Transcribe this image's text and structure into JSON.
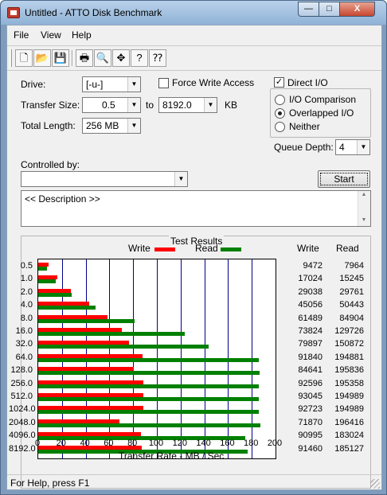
{
  "window": {
    "title": "Untitled - ATTO Disk Benchmark",
    "min_glyph": "—",
    "max_glyph": "□",
    "close_glyph": "X"
  },
  "menu": [
    "File",
    "View",
    "Help"
  ],
  "toolbar": {
    "buttons": [
      {
        "name": "new-icon",
        "glyph": "🗋"
      },
      {
        "name": "open-icon",
        "glyph": "📂"
      },
      {
        "name": "save-icon",
        "glyph": "💾"
      },
      {
        "name": "print-icon",
        "glyph": "🖶"
      },
      {
        "name": "print-preview-icon",
        "glyph": "🔍"
      },
      {
        "name": "move-icon",
        "glyph": "✥"
      },
      {
        "name": "help-icon",
        "glyph": "?"
      },
      {
        "name": "context-help-icon",
        "glyph": "⁇"
      }
    ]
  },
  "form": {
    "drive_label": "Drive:",
    "drive_value": "[-u-]",
    "force_write_label": "Force Write Access",
    "force_write_checked": false,
    "direct_io_label": "Direct I/O",
    "direct_io_checked": true,
    "direct_io_mark": "✓",
    "transfer_size_label": "Transfer Size:",
    "transfer_from": "0.5",
    "to_label": "to",
    "transfer_to": "8192.0",
    "kb_label": "KB",
    "total_length_label": "Total Length:",
    "total_length_value": "256 MB",
    "io_options": [
      {
        "label": "I/O Comparison",
        "selected": false
      },
      {
        "label": "Overlapped I/O",
        "selected": true
      },
      {
        "label": "Neither",
        "selected": false
      }
    ],
    "queue_depth_label": "Queue Depth:",
    "queue_depth_value": "4",
    "controlled_by_label": "Controlled by:",
    "controlled_by_value": "",
    "start_label": "Start",
    "description": "<< Description >>",
    "dropdown_glyph": "▼",
    "scroll_up_glyph": "▲",
    "scroll_down_glyph": "▼"
  },
  "results": {
    "title": "Test Results",
    "write_label": "Write",
    "read_label": "Read",
    "write_col": "Write",
    "read_col": "Read"
  },
  "chart_data": {
    "type": "bar",
    "orientation": "horizontal",
    "xlabel": "Transfer Rate - MB / Sec",
    "xlim": [
      0,
      200
    ],
    "xticks": [
      "0",
      "20",
      "40",
      "60",
      "80",
      "100",
      "120",
      "140",
      "160",
      "180",
      "200"
    ],
    "categories": [
      "0.5",
      "1.0",
      "2.0",
      "4.0",
      "8.0",
      "16.0",
      "32.0",
      "64.0",
      "128.0",
      "256.0",
      "512.0",
      "1024.0",
      "2048.0",
      "4096.0",
      "8192.0"
    ],
    "series": [
      {
        "name": "Write",
        "color": "#ff0000",
        "values": [
          9.0,
          16.2,
          27.7,
          43.0,
          58.6,
          70.4,
          76.2,
          87.6,
          80.7,
          88.3,
          88.7,
          88.4,
          68.5,
          86.8,
          87.2
        ],
        "labels": [
          "9472",
          "17024",
          "29038",
          "45056",
          "61489",
          "73824",
          "79897",
          "91840",
          "84641",
          "92596",
          "93045",
          "92723",
          "71870",
          "90995",
          "91460"
        ]
      },
      {
        "name": "Read",
        "color": "#008000",
        "values": [
          7.6,
          14.5,
          28.4,
          48.1,
          81.0,
          123.7,
          143.9,
          185.9,
          186.8,
          186.2,
          185.9,
          186.0,
          187.3,
          174.6,
          176.6
        ],
        "labels": [
          "7964",
          "15245",
          "29761",
          "50443",
          "84904",
          "129726",
          "150872",
          "194881",
          "195836",
          "195358",
          "194989",
          "194989",
          "196416",
          "183024",
          "185127"
        ]
      }
    ]
  },
  "status": {
    "text": "For Help, press F1"
  }
}
